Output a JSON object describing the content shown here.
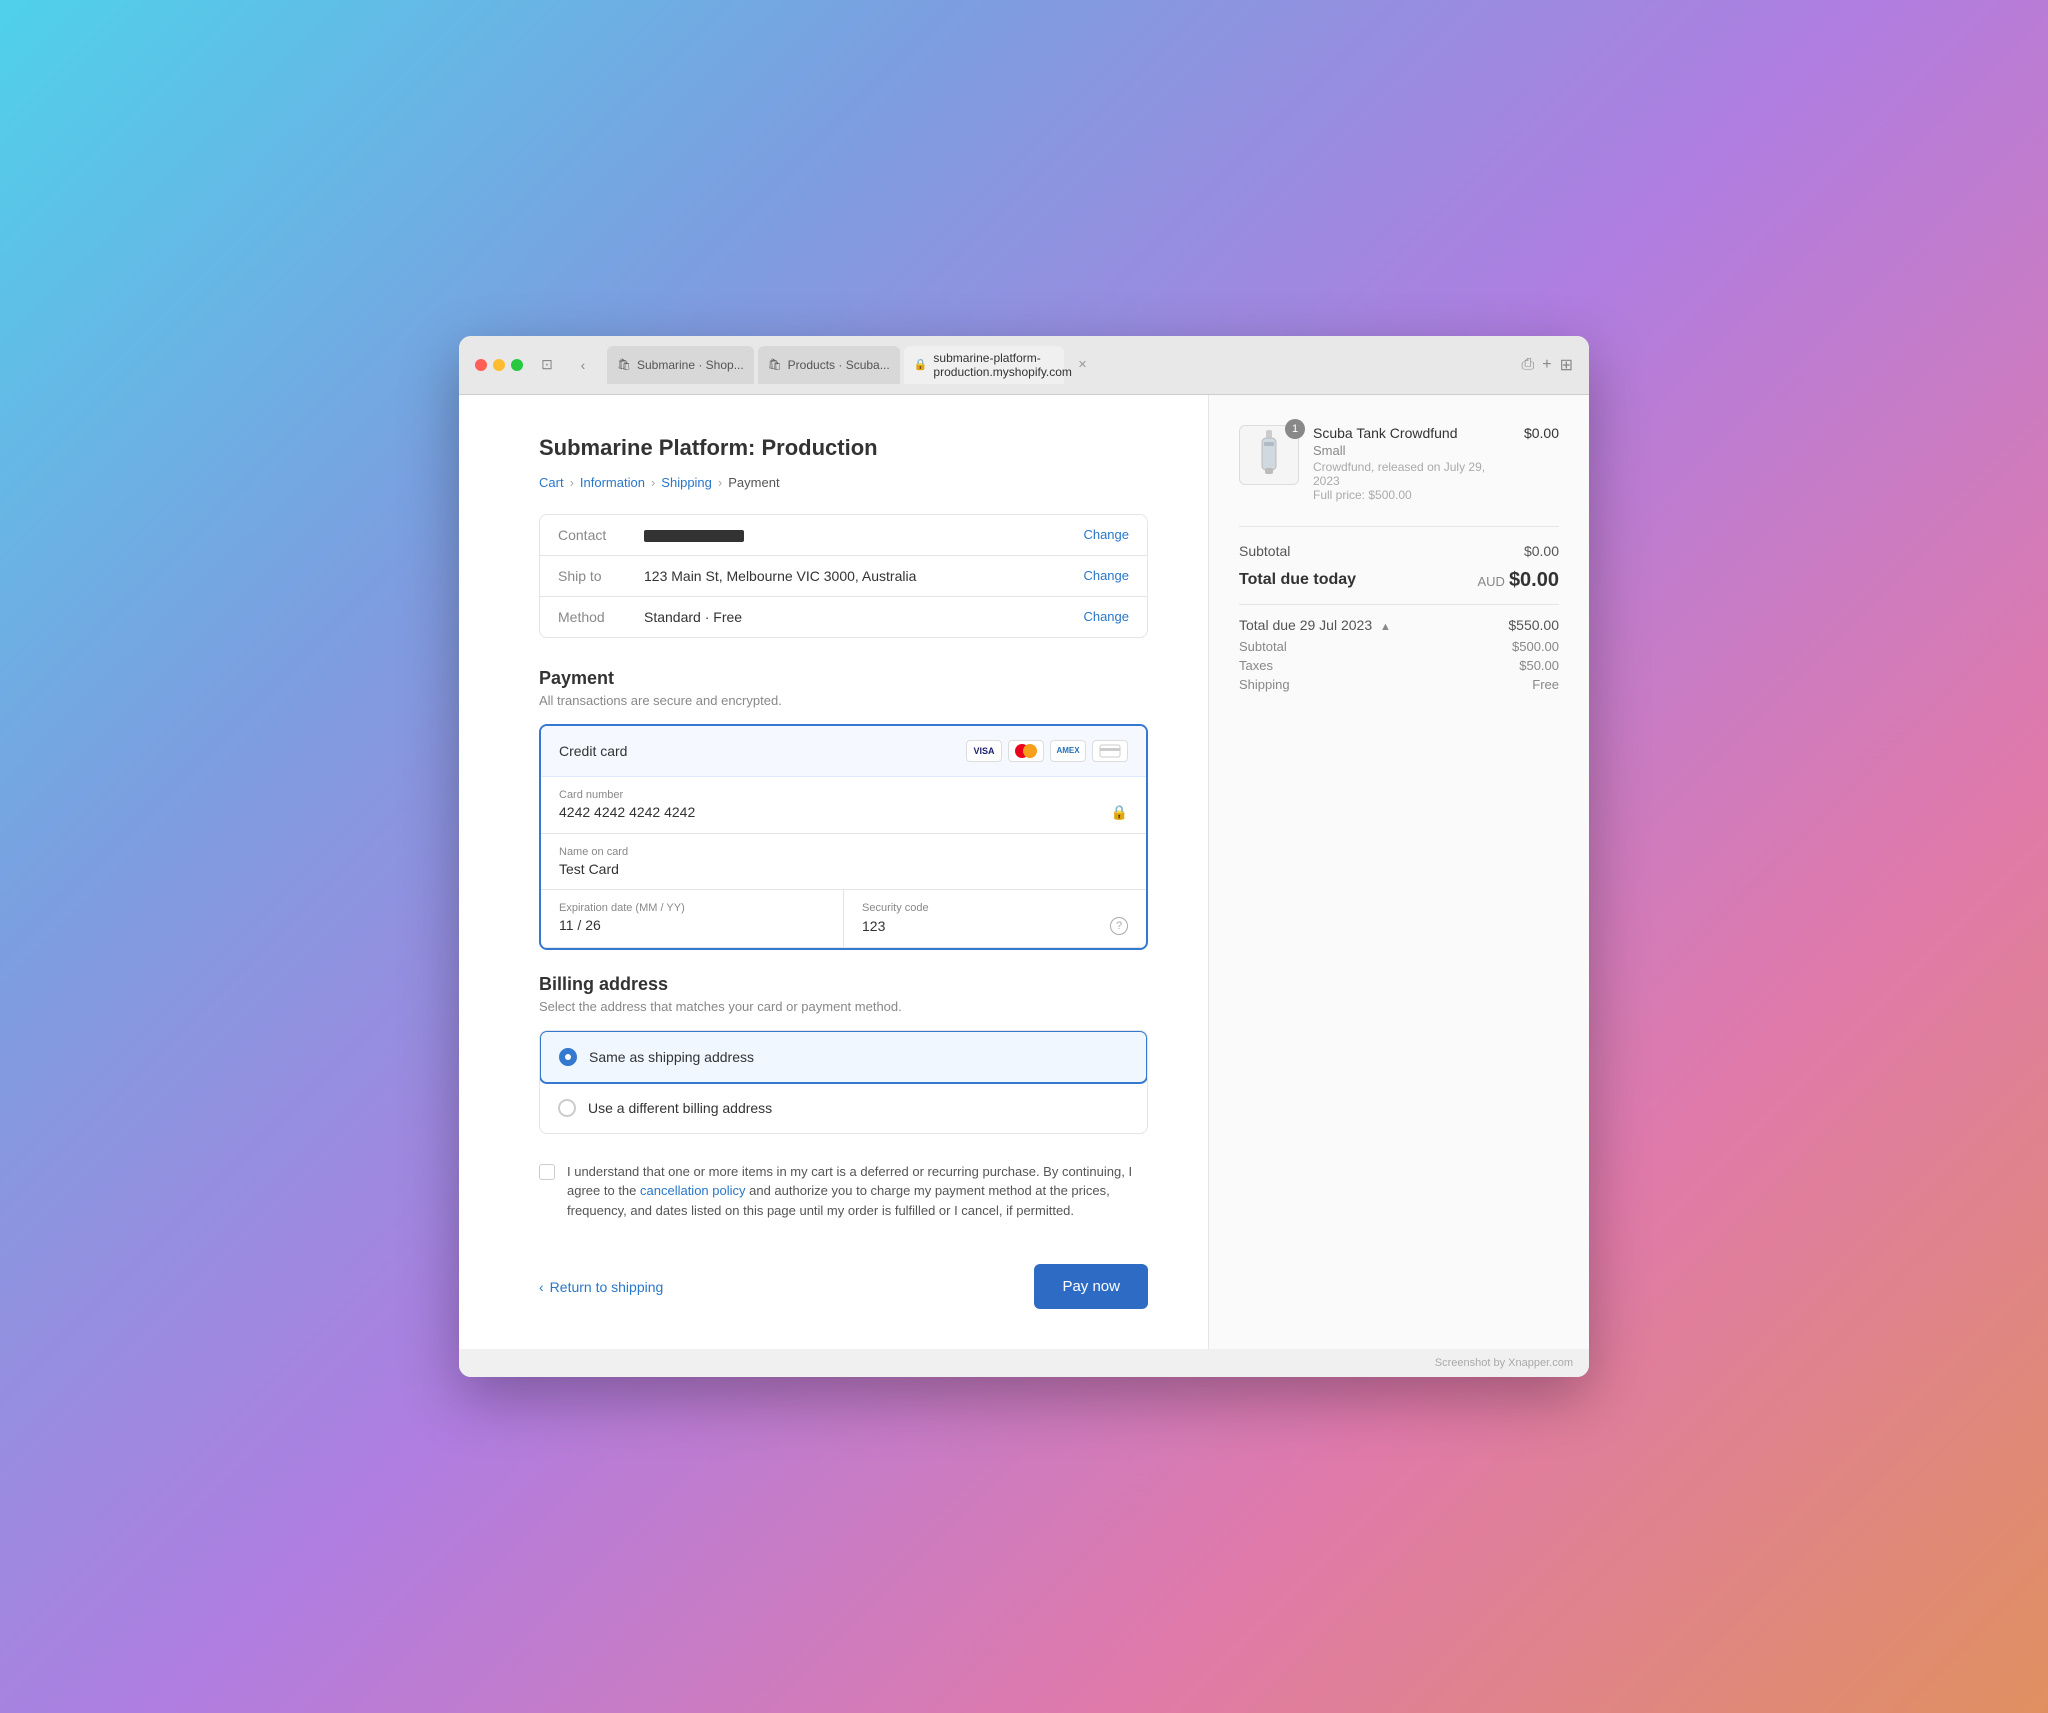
{
  "browser": {
    "tabs": [
      {
        "label": "Submarine · Shop...",
        "icon": "🛍",
        "active": false
      },
      {
        "label": "Products · Scuba...",
        "icon": "🛍",
        "active": false
      },
      {
        "label": "submarine-platform-production.myshopify.com",
        "icon": "🔒",
        "active": true
      }
    ],
    "url": "submarine-platform-production.myshopify.com",
    "url_secure": true
  },
  "page": {
    "store_title": "Submarine Platform: Production",
    "breadcrumb": {
      "cart": "Cart",
      "information": "Information",
      "shipping": "Shipping",
      "payment": "Payment"
    }
  },
  "summary": {
    "contact_label": "Contact",
    "contact_value": "••••••••••••••",
    "change_label": "Change",
    "ship_to_label": "Ship to",
    "ship_to_value": "123 Main St, Melbourne VIC 3000, Australia",
    "method_label": "Method",
    "method_value": "Standard · Free"
  },
  "payment": {
    "section_title": "Payment",
    "section_subtitle": "All transactions are secure and encrypted.",
    "credit_card_label": "Credit card",
    "card_number_label": "Card number",
    "card_number_value": "4242 4242 4242 4242",
    "name_on_card_label": "Name on card",
    "name_on_card_value": "Test Card",
    "expiration_label": "Expiration date (MM / YY)",
    "expiration_value": "11 / 26",
    "security_label": "Security code",
    "security_value": "123"
  },
  "billing": {
    "section_title": "Billing address",
    "section_subtitle": "Select the address that matches your card or payment method.",
    "option_same": "Same as shipping address",
    "option_different": "Use a different billing address"
  },
  "terms": {
    "text_part1": "I understand that one or more items in my cart is a deferred or recurring purchase. By continuing, I agree to the ",
    "link_text": "cancellation policy",
    "text_part2": " and authorize you to charge my payment method at the prices, frequency, and dates listed on this page until my order is fulfilled or I cancel, if permitted."
  },
  "footer": {
    "return_label": "Return to shipping",
    "pay_label": "Pay now"
  },
  "order": {
    "item_name": "Scuba Tank Crowdfund",
    "item_variant": "Small",
    "item_description": "Crowdfund, released on July 29, 2023",
    "item_full_price": "Full price: $500.00",
    "item_price": "$0.00",
    "item_quantity": "1",
    "subtotal_label": "Subtotal",
    "subtotal_value": "$0.00",
    "total_due_today_label": "Total due today",
    "total_currency": "AUD",
    "total_value": "$0.00",
    "due_date_label": "Total due 29 Jul 2023",
    "due_date_value": "$550.00",
    "due_subtotal_label": "Subtotal",
    "due_subtotal_value": "$500.00",
    "due_taxes_label": "Taxes",
    "due_taxes_value": "$50.00",
    "due_shipping_label": "Shipping",
    "due_shipping_value": "Free"
  },
  "screenshot": {
    "credit": "Screenshot by Xnapper.com"
  }
}
